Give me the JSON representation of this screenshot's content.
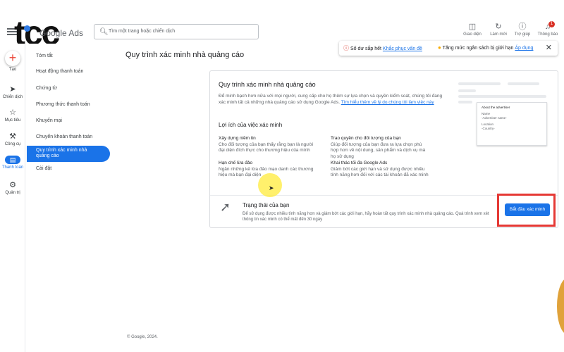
{
  "brand": {
    "logo_text": "tcc",
    "product": "Google Ads"
  },
  "search": {
    "placeholder": "Tìm một trang hoặc chiến dịch"
  },
  "toolbar": {
    "appearance": "Giao diện",
    "refresh": "Làm mới",
    "help": "Trợ giúp",
    "notifications": "Thông báo",
    "notifications_count": "1"
  },
  "alert": {
    "balance_text": "Số dư sắp hết",
    "balance_link": "Khắc phục vấn đề",
    "budget_text": "Tăng mức ngân sách bị giới hạn",
    "budget_link": "Áp dụng"
  },
  "rail": {
    "create": "Tạo",
    "campaigns": "Chiến dịch",
    "goals": "Mục tiêu",
    "tools": "Công cụ",
    "billing": "Thanh toán",
    "admin": "Quản trị"
  },
  "subnav": {
    "items": [
      "Tóm tắt",
      "Hoạt động thanh toán",
      "Chứng từ",
      "Phương thức thanh toán",
      "Khuyến mại",
      "Chuyển khoản thanh toán",
      "Quy trình xác minh nhà quảng cáo",
      "Cài đặt"
    ]
  },
  "page": {
    "title": "Quy trình xác minh nhà quảng cáo"
  },
  "card": {
    "title": "Quy trình xác minh nhà quảng cáo",
    "desc": "Để minh bạch hơn nữa với mọi người, cung cấp cho họ thêm sự lựa chọn và quyền kiểm soát, chúng tôi đang xác minh tất cả những nhà quảng cáo sử dụng Google Ads.",
    "desc_link": "Tìm hiểu thêm về lý do chúng tôi làm việc này",
    "benefits_title": "Lợi ích của việc xác minh",
    "benefits": [
      {
        "title": "Xây dựng niềm tin",
        "text": "Cho đối tượng của bạn thấy rằng bạn là người đại diện đích thực cho thương hiệu của mình"
      },
      {
        "title": "Trao quyền cho đối tượng của bạn",
        "text": "Giúp đối tượng của bạn đưa ra lựa chọn phù hợp hơn về nội dung, sản phẩm và dịch vụ mà họ sử dụng"
      },
      {
        "title": "Hạn chế lừa đảo",
        "text": "Ngăn những kẻ lừa đảo mạo danh các thương hiệu mà bạn đại diện"
      },
      {
        "title": "Khai thác tối đa Google Ads",
        "text": "Giảm bớt các giới hạn và sử dụng được nhiều tính năng hơn đối với các tài khoản đã xác minh"
      }
    ],
    "illustration": {
      "heading": "About the advertiser",
      "name_label": "Name",
      "name_value": "-Advertiser name-",
      "location_label": "Location",
      "location_value": "-Country-"
    },
    "status_title": "Trạng thái của bạn",
    "status_desc": "Để sử dụng được nhiều tính năng hơn và giảm bớt các giới hạn, hãy hoàn tất quy trình xác minh nhà quảng cáo. Quá trình xem xét thông tin xác minh có thể mất đến 30 ngày",
    "cta": "Bắt đầu xác minh"
  },
  "footer": "© Google, 2024."
}
